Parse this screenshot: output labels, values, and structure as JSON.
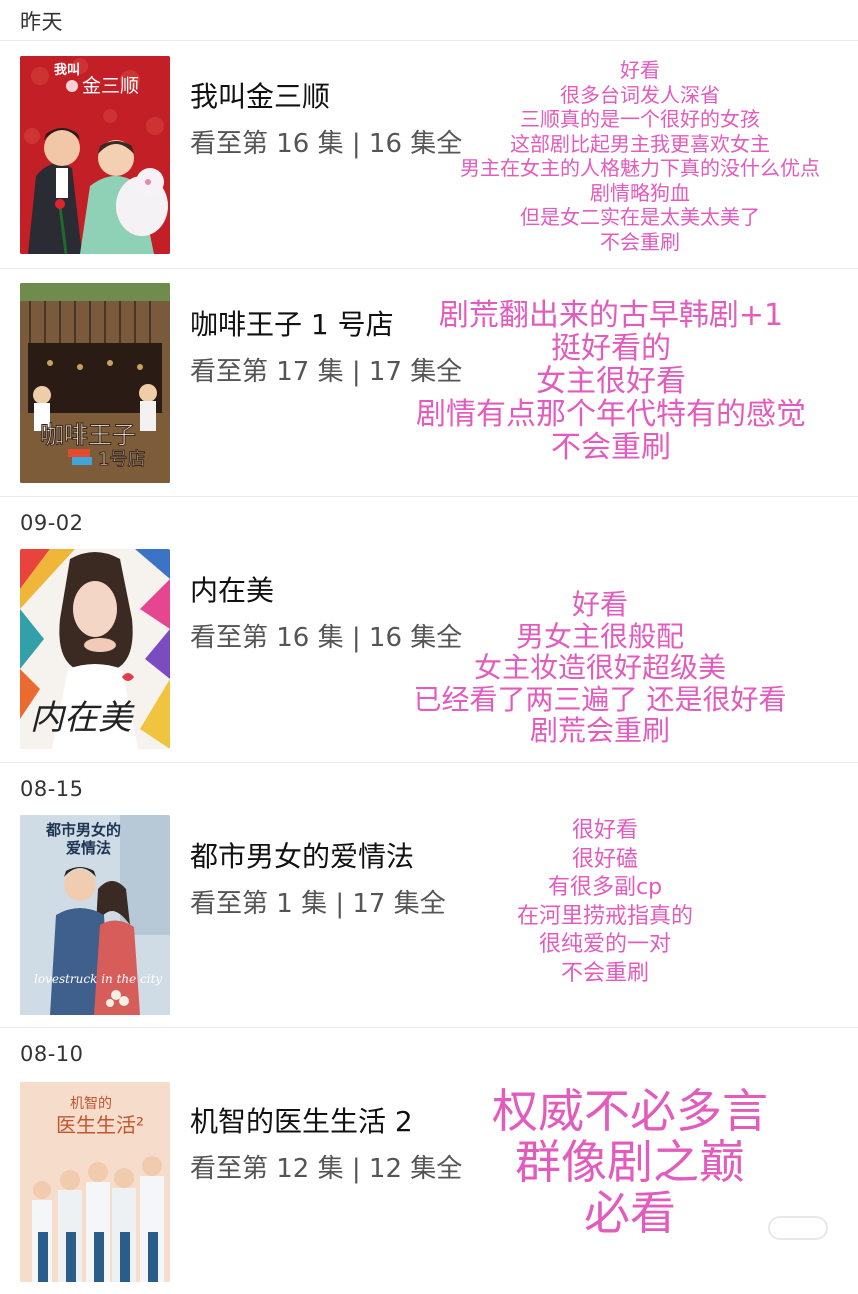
{
  "sections": {
    "yesterday": "昨天",
    "d0902": "09-02",
    "d0815": "08-15",
    "d0810": "08-10"
  },
  "items": [
    {
      "title": "我叫金三顺",
      "progress": "看至第 16 集 | 16 集全",
      "poster_text": "我叫 金三顺",
      "note": [
        "好看",
        "很多台词发人深省",
        "三顺真的是一个很好的女孩",
        "这部剧比起男主我更喜欢女主",
        "男主在女主的人格魅力下真的没什么优点",
        "剧情略狗血",
        "但是女二实在是太美太美了",
        "不会重刷"
      ]
    },
    {
      "title": "咖啡王子 1 号店",
      "progress": "看至第 17 集 | 17 集全",
      "poster_text": "咖啡王子 1号店",
      "note": [
        "剧荒翻出来的古早韩剧+1",
        "挺好看的",
        "女主很好看",
        "剧情有点那个年代特有的感觉",
        "不会重刷"
      ]
    },
    {
      "title": "内在美",
      "progress": "看至第 16 集 | 16 集全",
      "poster_text": "内在美",
      "note": [
        "好看",
        "男女主很般配",
        "女主妆造很好超级美",
        "已经看了两三遍了 还是很好看",
        "剧荒会重刷"
      ]
    },
    {
      "title": "都市男女的爱情法",
      "progress": "看至第 1 集 | 17 集全",
      "poster_text": "都市男女的 爱情法",
      "note": [
        "很好看",
        "很好磕",
        "有很多副cp",
        "在河里捞戒指真的",
        "很纯爱的一对",
        "不会重刷"
      ]
    },
    {
      "title": "机智的医生生活 2",
      "progress": "看至第 12 集 | 12 集全",
      "poster_text": "机智的 医生生活²",
      "note": [
        "权威不必多言",
        "群像剧之巅",
        "必看"
      ]
    }
  ],
  "colors": {
    "note_pink": "#e25bbd",
    "divider": "#ececec",
    "text_primary": "#111111",
    "text_secondary": "#555555"
  }
}
